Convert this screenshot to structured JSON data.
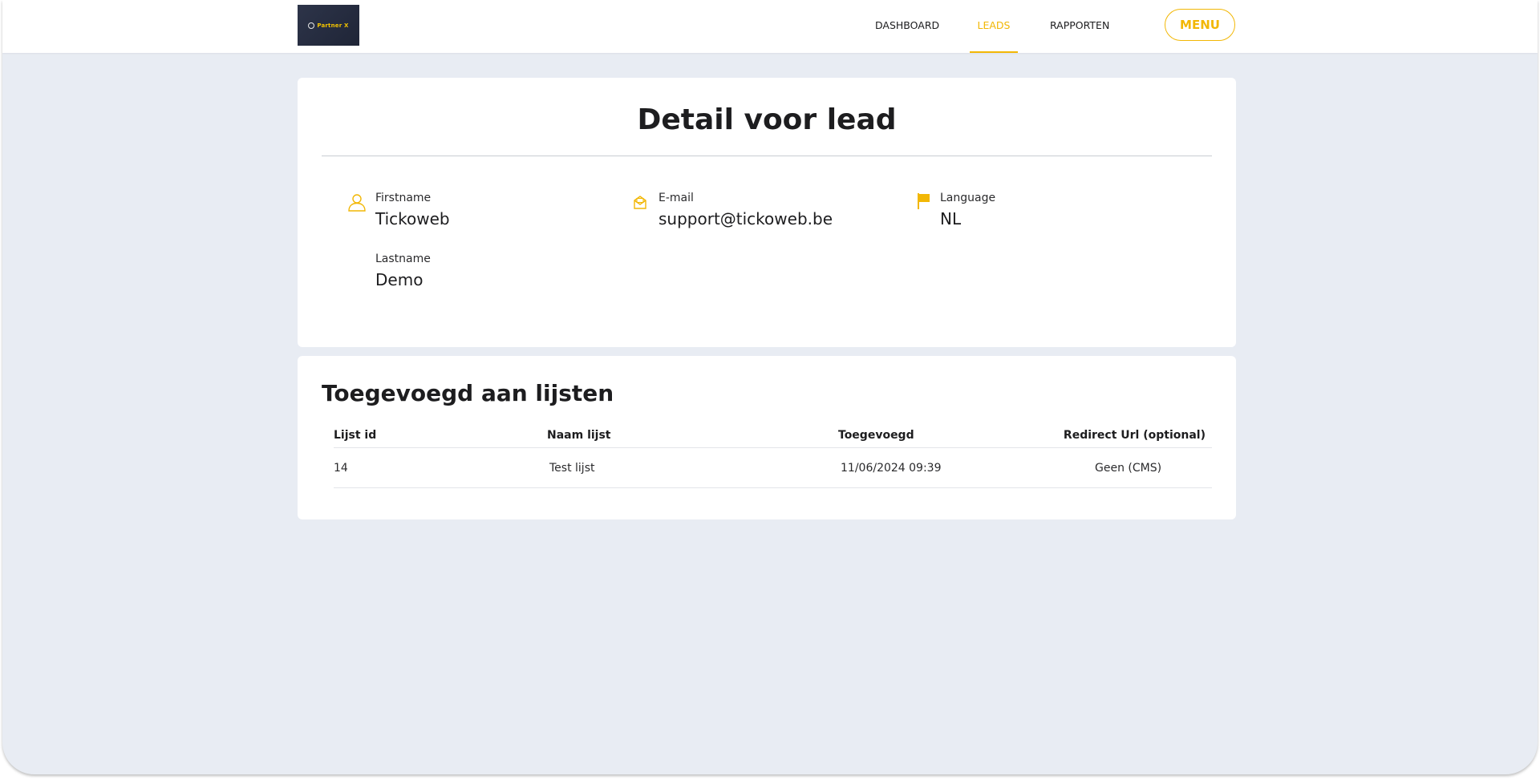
{
  "header": {
    "logo_text": "Partner X",
    "nav": [
      {
        "label": "DASHBOARD",
        "active": false
      },
      {
        "label": "LEADS",
        "active": true
      },
      {
        "label": "RAPPORTEN",
        "active": false
      }
    ],
    "menu_label": "MENU",
    "accent_color": "#f2b705"
  },
  "detail": {
    "title": "Detail voor lead",
    "firstname": {
      "label": "Firstname",
      "value": "Tickoweb",
      "icon": "user-icon"
    },
    "lastname": {
      "label": "Lastname",
      "value": "Demo"
    },
    "email": {
      "label": "E-mail",
      "value": "support@tickoweb.be",
      "icon": "envelope-icon"
    },
    "language": {
      "label": "Language",
      "value": "NL",
      "icon": "flag-icon"
    }
  },
  "lists": {
    "title": "Toegevoegd aan lijsten",
    "columns": [
      "Lijst id",
      "Naam lijst",
      "Toegevoegd",
      "Redirect Url (optional)"
    ],
    "rows": [
      {
        "id": "14",
        "name": "Test lijst",
        "added": "11/06/2024 09:39",
        "redirect": "Geen (CMS)"
      }
    ]
  }
}
